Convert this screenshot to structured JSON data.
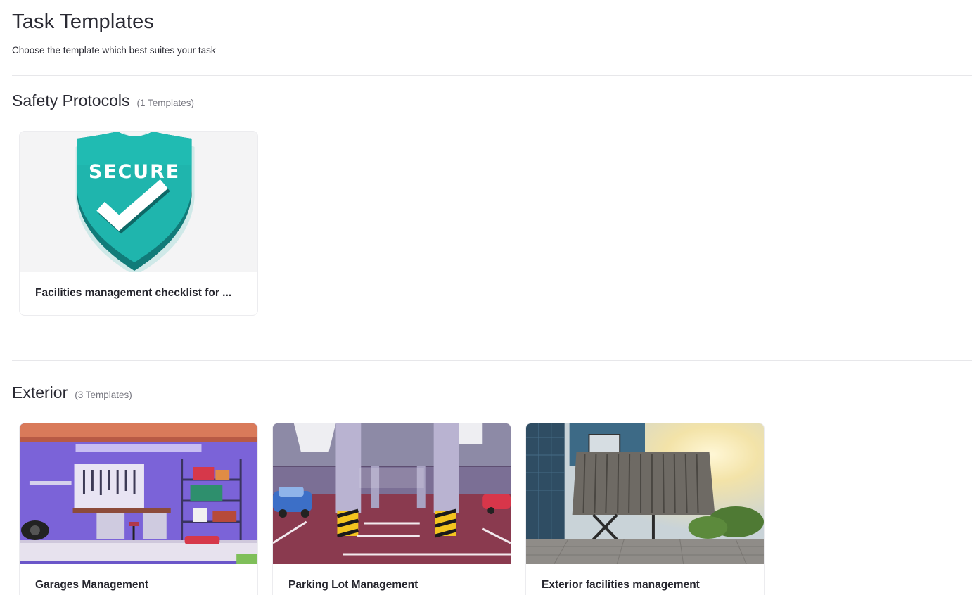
{
  "header": {
    "title": "Task Templates",
    "subtitle": "Choose the template which best suites your task"
  },
  "sections": [
    {
      "title": "Safety Protocols",
      "count": "(1 Templates)",
      "templates": [
        {
          "title": "Facilities management checklist for ...",
          "image_text": "SECURE"
        }
      ]
    },
    {
      "title": "Exterior",
      "count": "(3 Templates)",
      "templates": [
        {
          "title": "Garages Management"
        },
        {
          "title": "Parking Lot Management"
        },
        {
          "title": "Exterior facilities management"
        }
      ]
    }
  ],
  "colors": {
    "shield_teal": "#1fb5ad",
    "shield_dark": "#117b79",
    "garage_purple": "#6b56c9",
    "parking_red": "#8a3a4f"
  }
}
